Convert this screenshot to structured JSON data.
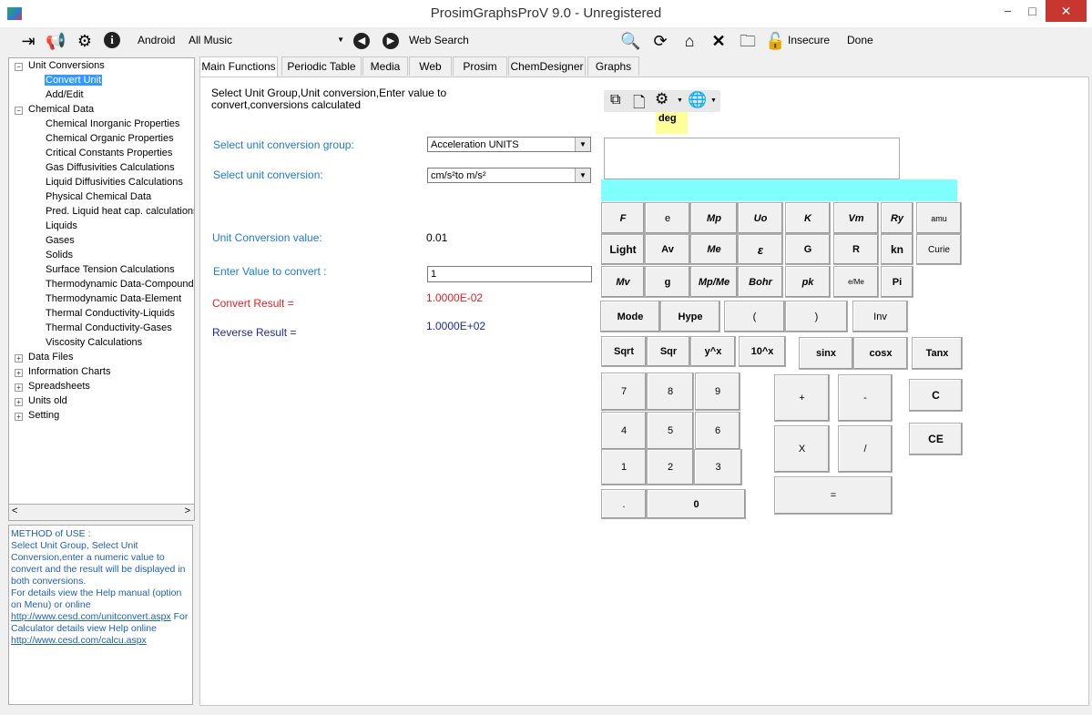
{
  "window": {
    "title": "ProsimGraphsProV 9.0 - Unregistered",
    "minimize": "−",
    "maximize": "□",
    "close": "✕"
  },
  "toolbar": {
    "android_label": "Android",
    "music_value": "All Music",
    "web_search_label": "Web Search",
    "insecure_label": "Insecure",
    "done_label": "Done"
  },
  "tree": {
    "unit_conversions": "Unit Conversions",
    "convert_unit": "Convert Unit",
    "add_edit": "Add/Edit",
    "chemical_data": "Chemical Data",
    "chemical_children": [
      "Chemical Inorganic Properties",
      "Chemical Organic Properties",
      "Critical Constants Properties",
      "Gas Diffusivities Calculations",
      "Liquid Diffusivities Calculations",
      "Physical Chemical Data",
      "Pred. Liquid heat cap. calculations",
      "Liquids",
      "Gases",
      "Solids",
      "Surface Tension Calculations",
      "Thermodynamic Data-Compound",
      "Thermodynamic Data-Element",
      "Thermal Conductivity-Liquids",
      "Thermal Conductivity-Gases",
      "Viscosity Calculations"
    ],
    "collapsed": [
      "Data Files",
      "Information Charts",
      "Spreadsheets",
      "Units old",
      "Setting"
    ]
  },
  "help": {
    "line1": "METHOD of USE :",
    "line2": "Select Unit Group, Select Unit Conversion,enter a numeric value to convert and the result will be displayed in both conversions.",
    "line3": " For details view the Help manual (option on Menu) or online",
    "link1": "http://www.cesd.com/unitconvert.aspx",
    "line4": " For Calculator details view Help online",
    "link2": "http://www.cesd.com/calcu.aspx"
  },
  "tabs": [
    "Main Functions",
    "Periodic Table",
    "Media",
    "Web",
    "Prosim",
    "ChemDesigner",
    "Graphs"
  ],
  "main": {
    "instructions": "Select Unit Group,Unit conversion,Enter value to convert,conversions calculated",
    "group_label": "Select unit conversion group:",
    "group_value": "Acceleration UNITS",
    "conversion_label": "Select unit conversion:",
    "conversion_value": "cm/s²to  m/s²",
    "conv_value_label": "Unit Conversion value:",
    "conv_value": "0.01",
    "enter_label": "Enter Value to convert :",
    "enter_value": "1",
    "convert_result_label": "Convert Result =",
    "convert_result": "1.0000E-02",
    "reverse_result_label": "Reverse Result =",
    "reverse_result": "1.0000E+02"
  },
  "calculator": {
    "angle_mode": "deg",
    "display": "",
    "keys": {
      "F": "F",
      "e": "e",
      "Mp": "Mp",
      "Uo": "Uo",
      "K": "K",
      "Vm": "Vm",
      "Ry": "Ry",
      "amu": "amu",
      "Light": "Light",
      "Av": "Av",
      "Me": "Me",
      "epsilon": "ε",
      "G": "G",
      "R": "R",
      "kn": "kn",
      "Curie": "Curie",
      "Mv": "Mv",
      "g": "g",
      "MpMe": "Mp/Me",
      "Bohr": "Bohr",
      "pk": "pk",
      "eMe": "e/Me",
      "Pi": "Pi",
      "Mode": "Mode",
      "Hype": "Hype",
      "lparen": "(",
      "rparen": ")",
      "Inv": "Inv",
      "Sqrt": "Sqrt",
      "Sqr": "Sqr",
      "ypowx": "y^x",
      "tenpowx": "10^x",
      "sinx": "sinx",
      "cosx": "cosx",
      "Tanx": "Tanx",
      "n7": "7",
      "n8": "8",
      "n9": "9",
      "n4": "4",
      "n5": "5",
      "n6": "6",
      "n1": "1",
      "n2": "2",
      "n3": "3",
      "dot": ".",
      "n0": "0",
      "plus": "+",
      "minus": "-",
      "times": "X",
      "divide": "/",
      "equals": "=",
      "C": "C",
      "CE": "CE"
    }
  }
}
